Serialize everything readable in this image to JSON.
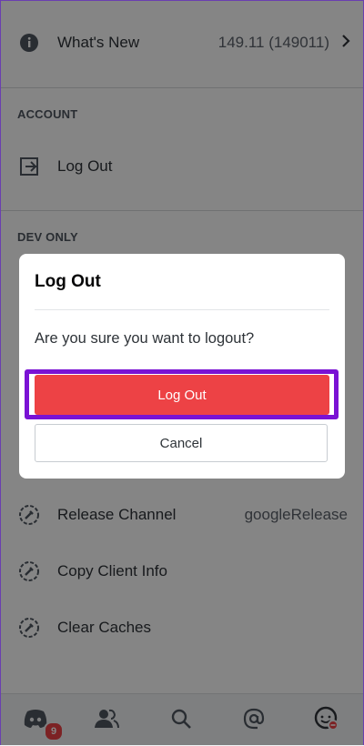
{
  "settings": {
    "whats_new": {
      "label": "What's New",
      "value": "149.11 (149011)"
    },
    "account_section": "ACCOUNT",
    "log_out": {
      "label": "Log Out"
    },
    "dev_only_section": "DEV ONLY",
    "release_channel": {
      "label": "Release Channel",
      "value": "googleRelease"
    },
    "copy_client_info": {
      "label": "Copy Client Info"
    },
    "clear_caches": {
      "label": "Clear Caches"
    }
  },
  "tabbar": {
    "badge_count": "9",
    "icons": [
      "discord-home-icon",
      "friends-icon",
      "search-icon",
      "mentions-icon",
      "profile-icon"
    ]
  },
  "dialog": {
    "title": "Log Out",
    "message": "Are you sure you want to logout?",
    "confirm_label": "Log Out",
    "cancel_label": "Cancel"
  },
  "colors": {
    "danger": "#ed4245",
    "highlight": "#7a12d4",
    "overlay": "rgba(0,0,0,0.48)"
  }
}
